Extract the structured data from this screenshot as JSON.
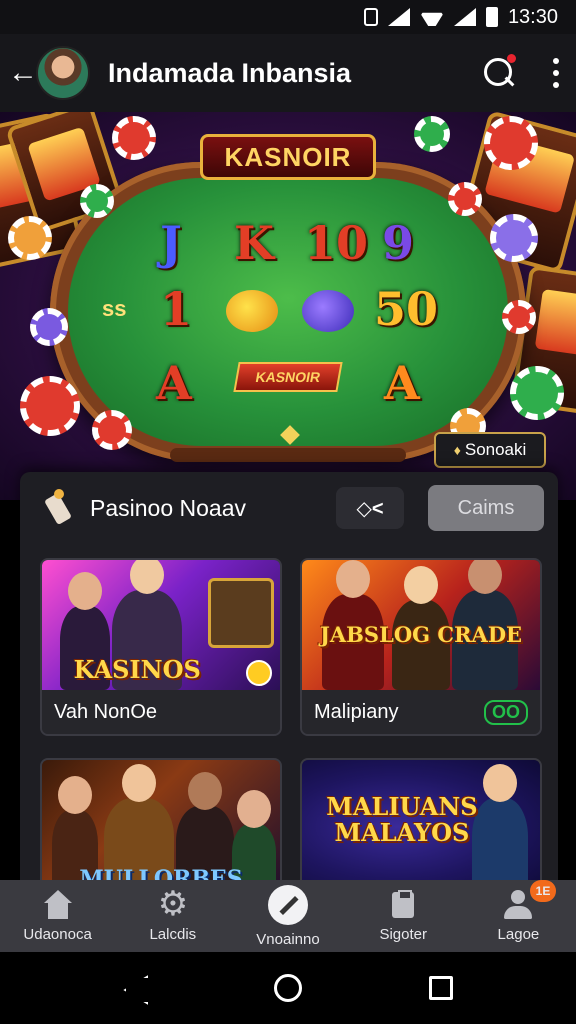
{
  "status_bar": {
    "time": "13:30"
  },
  "app_bar": {
    "title": "Indamada Inbansia"
  },
  "hero": {
    "title_sign": "KASNOIR",
    "symbols_row1": [
      "J",
      "K",
      "10",
      "9"
    ],
    "symbols_row2": [
      "1",
      "50"
    ],
    "symbols_row3": [
      "A",
      "A"
    ],
    "side_text": "ss",
    "center_banner": "KASNOIR",
    "corner_badge": "Sonoaki"
  },
  "panel": {
    "title": "Pasinoo Noaav",
    "code_button": "◇<",
    "claims_button": "Caims"
  },
  "cards": [
    {
      "art_text": "KASINOS",
      "label": "Vah NonOe",
      "badge": ""
    },
    {
      "art_text": "JABSLOG CRADE",
      "label": "Malipiany",
      "badge": "OO"
    },
    {
      "art_text": "MULLORBES",
      "label": "",
      "badge": ""
    },
    {
      "art_text": "MALIUANS MALAYOS",
      "label": "",
      "badge": ""
    }
  ],
  "bottom_nav": [
    {
      "label": "Udaonoca",
      "icon": "home-icon"
    },
    {
      "label": "Lalcdis",
      "icon": "gear-icon"
    },
    {
      "label": "Vnoainno",
      "icon": "center-action-icon"
    },
    {
      "label": "Sigoter",
      "icon": "clipboard-icon"
    },
    {
      "label": "Lagoe",
      "icon": "user-icon",
      "badge": "1E"
    }
  ],
  "colors": {
    "felt": "#27913a",
    "accent": "#ffd463",
    "nav_bg": "#3a3a40"
  }
}
